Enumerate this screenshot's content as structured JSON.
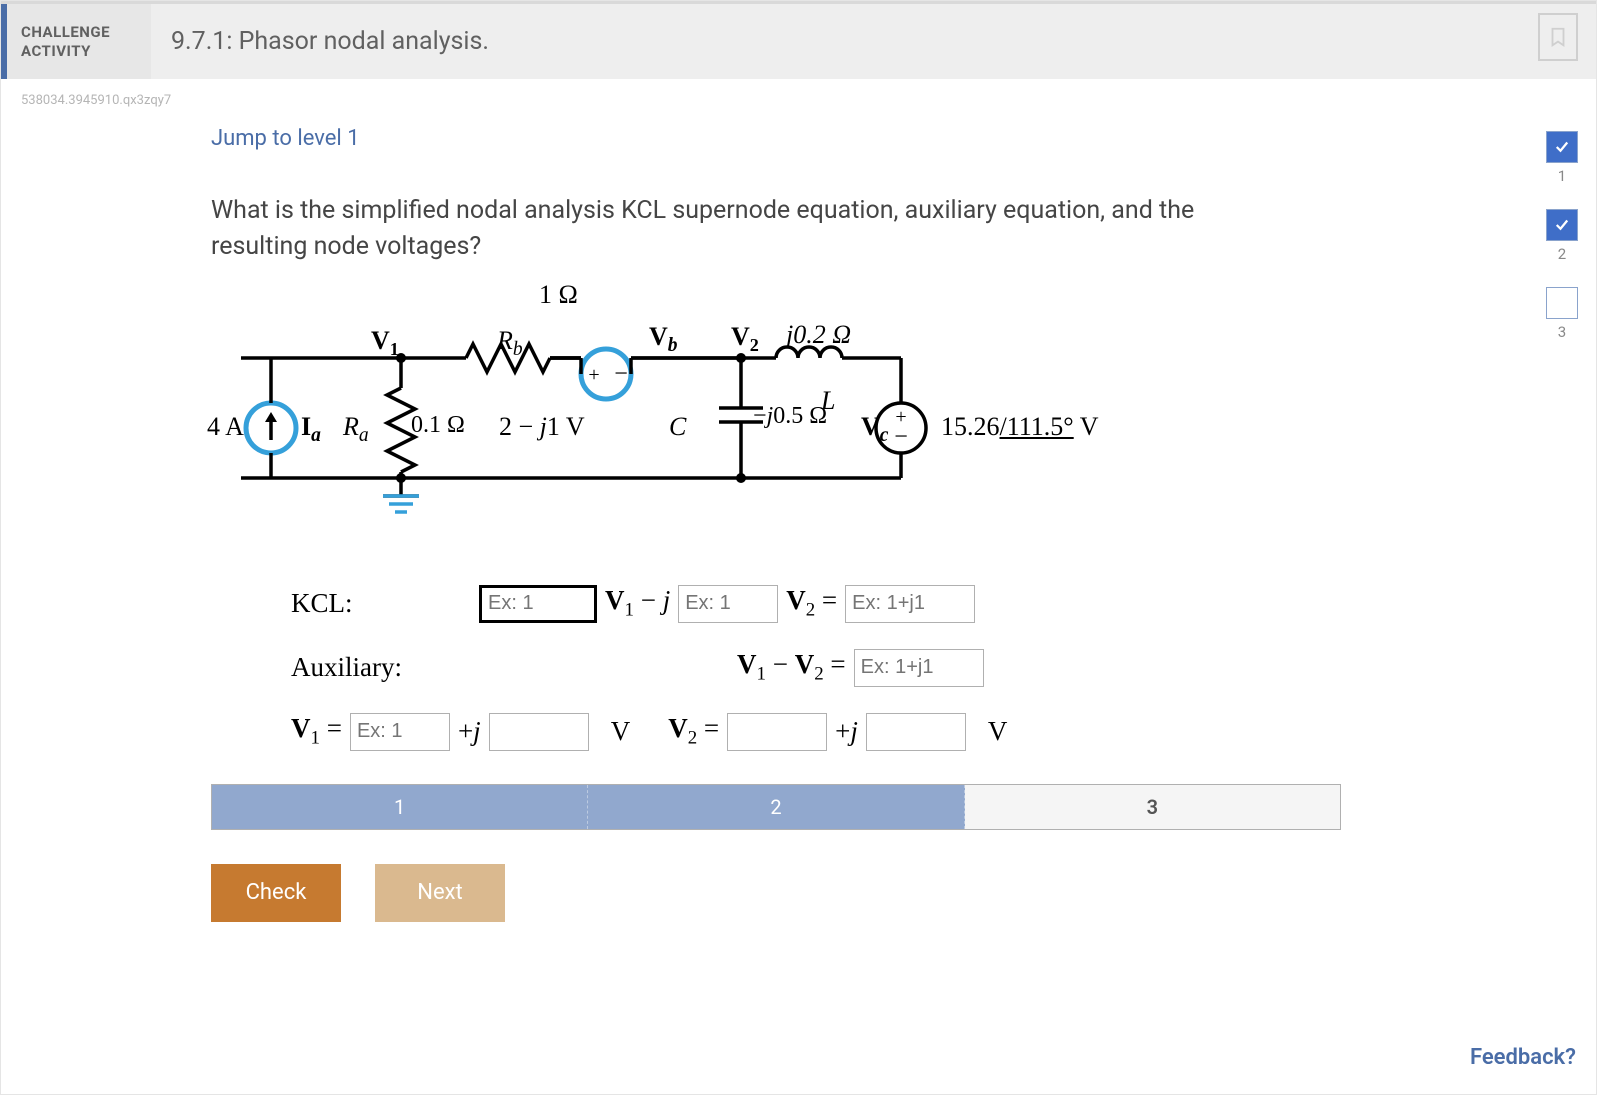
{
  "header": {
    "badge_line1": "CHALLENGE",
    "badge_line2": "ACTIVITY",
    "title": "9.7.1: Phasor nodal analysis."
  },
  "question_id": "538034.3945910.qx3zqy7",
  "jump_link": "Jump to level 1",
  "prompt": "What is the simplified nodal analysis KCL supernode equation, auxiliary equation, and the resulting node voltages?",
  "circuit": {
    "top_res_val": "1 Ω",
    "Rb": "R",
    "Rb_sub": "b",
    "V1": "V",
    "Vb": "V",
    "V2": "V",
    "ind_val": "j0.2 Ω",
    "Ia_source": "4 A",
    "Ia": "I",
    "Ra": "R",
    "Ra_val": "0.1 Ω",
    "Vb_src": "2 − j1 V",
    "C": "C",
    "cap_val": "−j0.5 Ω",
    "L": "L",
    "Vc": "V",
    "Vc_src": "15.26∠111.5° V"
  },
  "equations": {
    "kcl_label": "KCL:",
    "aux_label": "Auxiliary:",
    "ph_ex1": "Ex: 1",
    "ph_ex1j1": "Ex: 1+j1",
    "unit_V": "V"
  },
  "progress": {
    "seg1": "1",
    "seg2": "2",
    "seg3": "3"
  },
  "buttons": {
    "check": "Check",
    "next": "Next"
  },
  "indicators": {
    "i1": "1",
    "i2": "2",
    "i3": "3"
  },
  "feedback": "Feedback?"
}
